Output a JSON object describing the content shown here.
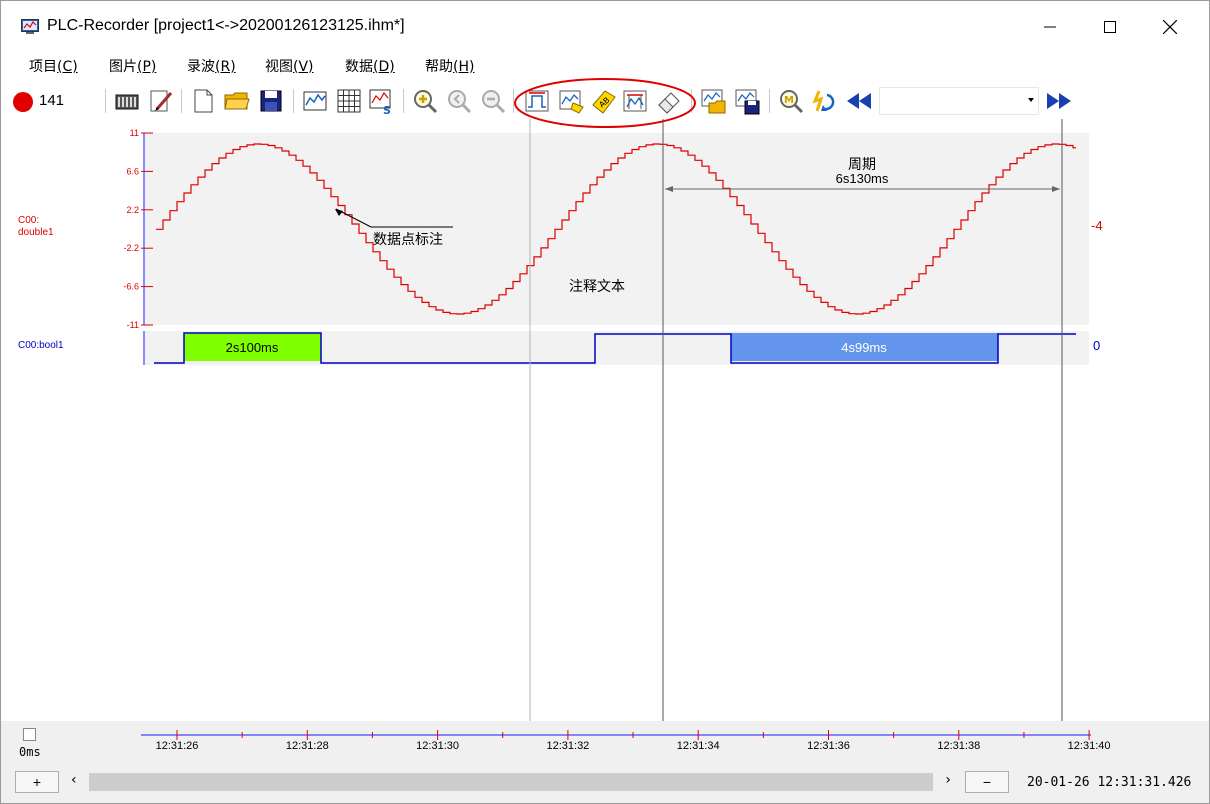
{
  "window": {
    "title": "PLC-Recorder  [project1<->20200126123125.ihm*]",
    "controls": {
      "minimize": "—",
      "maximize": "☐",
      "close": "✕"
    }
  },
  "menu": [
    {
      "label": "项目",
      "key": "(C)"
    },
    {
      "label": "图片",
      "key": "(P)"
    },
    {
      "label": "录波",
      "key": "(R)"
    },
    {
      "label": "视图",
      "key": "(V)"
    },
    {
      "label": "数据",
      "key": "(D)"
    },
    {
      "label": "帮助",
      "key": "(H)"
    }
  ],
  "toolbar": {
    "record_count": "141",
    "combo_value": "",
    "icons": [
      "config-icon",
      "edit-icon",
      "new-file-icon",
      "open-folder-icon",
      "save-icon",
      "trend-icon",
      "grid-icon",
      "curve-setting-icon",
      "zoom-in-icon",
      "zoom-out-icon",
      "zoom-reset-icon",
      "period-mark-icon",
      "data-point-mark-icon",
      "annotation-tag-icon",
      "range-mark-icon",
      "eraser-icon",
      "export-image-icon",
      "save-image-icon",
      "magnify-m-icon",
      "refresh-icon",
      "rewind-icon",
      "fast-forward-icon"
    ],
    "highlight_color": "#e00000"
  },
  "chart_data": [
    {
      "type": "line",
      "name_label": "C00:\ndouble1",
      "series": [
        {
          "name": "C00:double1",
          "color": "#e00000"
        }
      ],
      "x": [
        "12:31:26",
        "12:31:28",
        "12:31:30",
        "12:31:32",
        "12:31:34",
        "12:31:36",
        "12:31:38",
        "12:31:40"
      ],
      "y_ticks": [
        "11",
        "6.6",
        "2.2",
        "-2.2",
        "-6.6",
        "-11"
      ],
      "ylim": [
        -11,
        11
      ],
      "right_value": "-4",
      "annotations": {
        "data_point": "数据点标注",
        "comment": "注释文本",
        "period_title": "周期",
        "period_value": "6s130ms"
      }
    },
    {
      "type": "line",
      "name_label": "C00:bool1",
      "series": [
        {
          "name": "C00:bool1",
          "color": "#0000c8"
        }
      ],
      "right_value": "0",
      "ranges": [
        {
          "label": "2s100ms",
          "color": "#7fff00"
        },
        {
          "label": "4s99ms",
          "color": "#6495ed"
        }
      ]
    }
  ],
  "status": {
    "offset": "0ms",
    "datetime": "20-01-26 12:31:31.426",
    "plus_label": "+",
    "minus_label": "−",
    "scroll_left": "‹",
    "scroll_right": "›"
  }
}
